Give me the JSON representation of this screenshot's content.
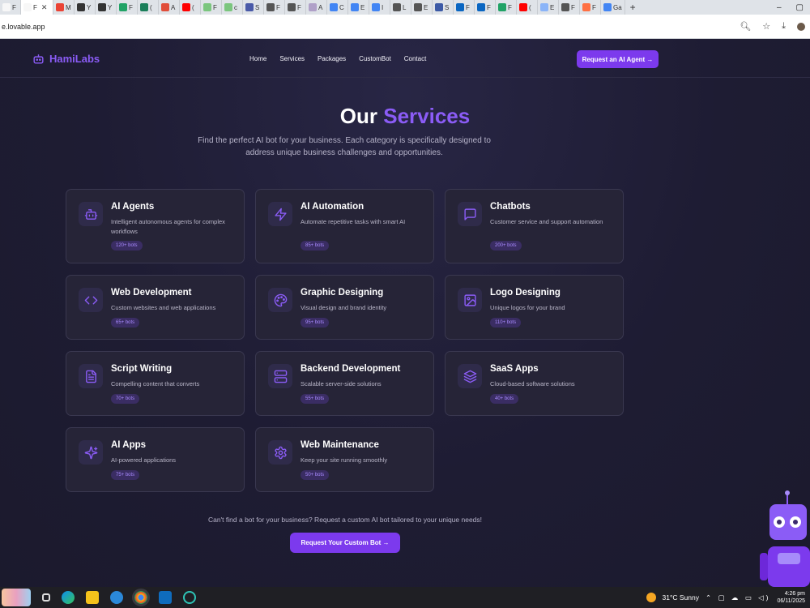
{
  "browser": {
    "url": "e.lovable.app",
    "tabs": [
      {
        "label": "F",
        "color": "#f7f7f7",
        "active": false
      },
      {
        "label": "F",
        "color": "#f7f7f7",
        "active": true
      },
      {
        "label": "M",
        "color": "#ea4335",
        "active": false
      },
      {
        "label": "Y",
        "color": "#333333",
        "active": false
      },
      {
        "label": "Y",
        "color": "#333333",
        "active": false
      },
      {
        "label": "F",
        "color": "#21a366",
        "active": false
      },
      {
        "label": "(",
        "color": "#1a7f5a",
        "active": false
      },
      {
        "label": "A",
        "color": "#e14e3a",
        "active": false
      },
      {
        "label": "(",
        "color": "#ff0000",
        "active": false
      },
      {
        "label": "F",
        "color": "#7bc67e",
        "active": false
      },
      {
        "label": "c",
        "color": "#7bc67e",
        "active": false
      },
      {
        "label": "S",
        "color": "#4a5aa8",
        "active": false
      },
      {
        "label": "F",
        "color": "#555555",
        "active": false
      },
      {
        "label": "F",
        "color": "#555555",
        "active": false
      },
      {
        "label": "A",
        "color": "#b0a0c8",
        "active": false
      },
      {
        "label": "C",
        "color": "#4285f4",
        "active": false
      },
      {
        "label": "E",
        "color": "#4285f4",
        "active": false
      },
      {
        "label": "I",
        "color": "#4285f4",
        "active": false
      },
      {
        "label": "L",
        "color": "#555555",
        "active": false
      },
      {
        "label": "E",
        "color": "#555555",
        "active": false
      },
      {
        "label": "S",
        "color": "#3c5aa6",
        "active": false
      },
      {
        "label": "F",
        "color": "#0a66c2",
        "active": false
      },
      {
        "label": "F",
        "color": "#0a66c2",
        "active": false
      },
      {
        "label": "F",
        "color": "#21a366",
        "active": false
      },
      {
        "label": "(",
        "color": "#ff0000",
        "active": false
      },
      {
        "label": "E",
        "color": "#8ab4f8",
        "active": false
      },
      {
        "label": "F",
        "color": "#555555",
        "active": false
      },
      {
        "label": "F",
        "color": "#ff7043",
        "active": false
      },
      {
        "label": "Ga",
        "color": "#4285f4",
        "active": false
      }
    ],
    "new_tab": "+",
    "controls": [
      "–",
      "▢"
    ]
  },
  "site": {
    "logo_text": "HamiLabs",
    "nav": [
      "Home",
      "Services",
      "Packages",
      "CustomBot",
      "Contact"
    ],
    "nav_cta": "Request an AI Agent →",
    "heading_main": "Our ",
    "heading_accent": "Services",
    "subtitle": "Find the perfect AI bot for your business. Each category is specifically designed to address unique business challenges and opportunities.",
    "services": [
      {
        "title": "AI Agents",
        "desc": "Intelligent autonomous agents for complex workflows",
        "badge": "120+ bots",
        "icon": "bot-icon"
      },
      {
        "title": "AI Automation",
        "desc": "Automate repetitive tasks with smart AI",
        "badge": "85+ bots",
        "icon": "lightning-icon"
      },
      {
        "title": "Chatbots",
        "desc": "Customer service and support automation",
        "badge": "200+ bots",
        "icon": "chat-icon"
      },
      {
        "title": "Web Development",
        "desc": "Custom websites and web applications",
        "badge": "65+ bots",
        "icon": "code-icon"
      },
      {
        "title": "Graphic Designing",
        "desc": "Visual design and brand identity",
        "badge": "95+ bots",
        "icon": "palette-icon"
      },
      {
        "title": "Logo Designing",
        "desc": "Unique logos for your brand",
        "badge": "110+ bots",
        "icon": "image-icon"
      },
      {
        "title": "Script Writing",
        "desc": "Compelling content that converts",
        "badge": "70+ bots",
        "icon": "document-icon"
      },
      {
        "title": "Backend Development",
        "desc": "Scalable server-side solutions",
        "badge": "55+ bots",
        "icon": "server-icon"
      },
      {
        "title": "SaaS Apps",
        "desc": "Cloud-based software solutions",
        "badge": "40+ bots",
        "icon": "layers-icon"
      },
      {
        "title": "AI Apps",
        "desc": "AI-powered applications",
        "badge": "75+ bots",
        "icon": "sparkle-icon"
      },
      {
        "title": "Web Maintenance",
        "desc": "Keep your site running smoothly",
        "badge": "50+ bots",
        "icon": "gear-icon"
      }
    ],
    "bottom_text": "Can't find a bot for your business? Request a custom AI bot tailored to your unique needs!",
    "bottom_cta": "Request Your Custom Bot →",
    "accent_color": "#7c3aed"
  },
  "taskbar": {
    "weather": "31°C  Sunny",
    "time": "4:26 pm",
    "date": "06/11/2025"
  }
}
